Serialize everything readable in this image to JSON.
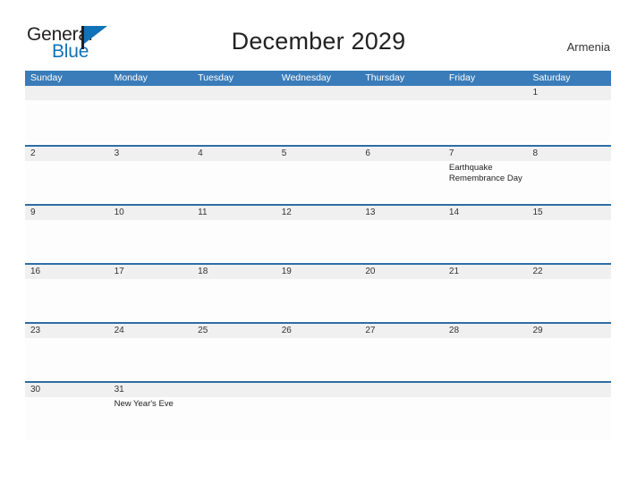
{
  "brand": {
    "name_part1": "General",
    "name_part2": "Blue"
  },
  "header": {
    "title": "December 2029",
    "country": "Armenia"
  },
  "colors": {
    "header_blue": "#3a7cb9",
    "rule_blue": "#2e6da4",
    "brand_blue": "#1272b8",
    "num_band": "#f0f0f0"
  },
  "calendar": {
    "weekdays": [
      "Sunday",
      "Monday",
      "Tuesday",
      "Wednesday",
      "Thursday",
      "Friday",
      "Saturday"
    ],
    "weeks": [
      {
        "days": [
          {
            "num": "",
            "events": []
          },
          {
            "num": "",
            "events": []
          },
          {
            "num": "",
            "events": []
          },
          {
            "num": "",
            "events": []
          },
          {
            "num": "",
            "events": []
          },
          {
            "num": "",
            "events": []
          },
          {
            "num": "1",
            "events": []
          }
        ]
      },
      {
        "days": [
          {
            "num": "2",
            "events": []
          },
          {
            "num": "3",
            "events": []
          },
          {
            "num": "4",
            "events": []
          },
          {
            "num": "5",
            "events": []
          },
          {
            "num": "6",
            "events": []
          },
          {
            "num": "7",
            "events": [
              "Earthquake Remembrance Day"
            ]
          },
          {
            "num": "8",
            "events": []
          }
        ]
      },
      {
        "days": [
          {
            "num": "9",
            "events": []
          },
          {
            "num": "10",
            "events": []
          },
          {
            "num": "11",
            "events": []
          },
          {
            "num": "12",
            "events": []
          },
          {
            "num": "13",
            "events": []
          },
          {
            "num": "14",
            "events": []
          },
          {
            "num": "15",
            "events": []
          }
        ]
      },
      {
        "days": [
          {
            "num": "16",
            "events": []
          },
          {
            "num": "17",
            "events": []
          },
          {
            "num": "18",
            "events": []
          },
          {
            "num": "19",
            "events": []
          },
          {
            "num": "20",
            "events": []
          },
          {
            "num": "21",
            "events": []
          },
          {
            "num": "22",
            "events": []
          }
        ]
      },
      {
        "days": [
          {
            "num": "23",
            "events": []
          },
          {
            "num": "24",
            "events": []
          },
          {
            "num": "25",
            "events": []
          },
          {
            "num": "26",
            "events": []
          },
          {
            "num": "27",
            "events": []
          },
          {
            "num": "28",
            "events": []
          },
          {
            "num": "29",
            "events": []
          }
        ]
      },
      {
        "days": [
          {
            "num": "30",
            "events": []
          },
          {
            "num": "31",
            "events": [
              "New Year's Eve"
            ]
          },
          {
            "num": "",
            "events": []
          },
          {
            "num": "",
            "events": []
          },
          {
            "num": "",
            "events": []
          },
          {
            "num": "",
            "events": []
          },
          {
            "num": "",
            "events": []
          }
        ]
      }
    ]
  }
}
